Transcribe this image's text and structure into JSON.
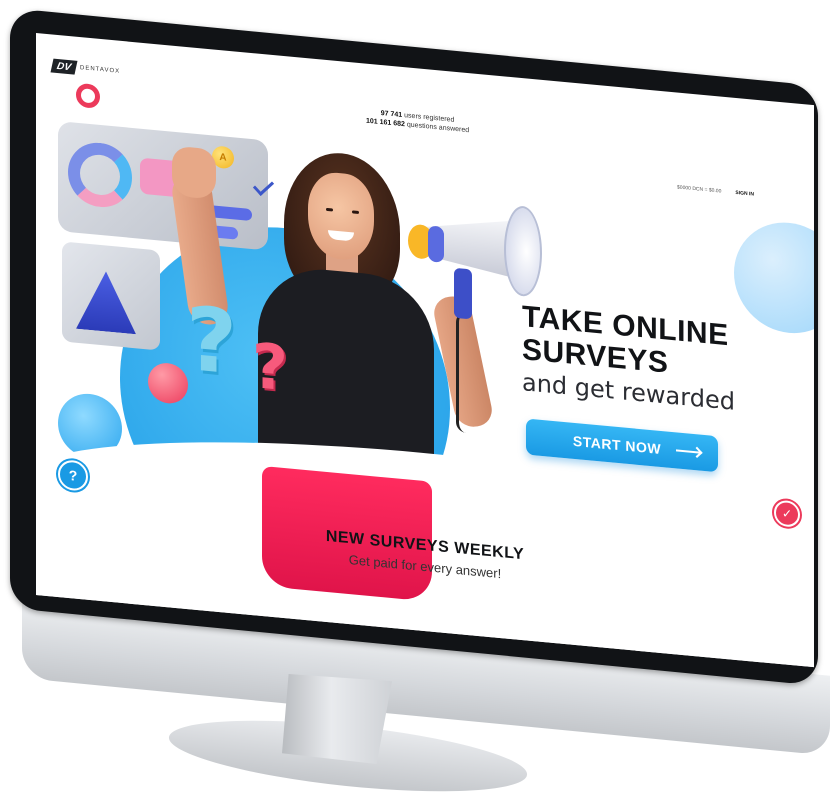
{
  "brand": {
    "logo_mark": "DV",
    "logo_text": "DENTAVOX"
  },
  "stats": {
    "users_count": "97 741",
    "users_label": "users registered",
    "questions_count": "101 161 682",
    "questions_label": "questions answered"
  },
  "nav": {
    "currency": "$0000 DCN = $0.00",
    "sign_in": "SIGN IN"
  },
  "hero": {
    "title_line1": "TAKE ONLINE",
    "title_line2": "SURVEYS",
    "subtitle": "and get rewarded",
    "cta_label": "START NOW"
  },
  "section": {
    "title": "NEW SURVEYS WEEKLY",
    "subtitle": "Get paid for every answer!"
  },
  "icons": {
    "help": "?",
    "badge": "✓",
    "coin": "A",
    "qmark": "?"
  },
  "colors": {
    "accent_blue": "#1a9ae4",
    "accent_pink": "#ec3a5b",
    "text_dark": "#111316"
  }
}
